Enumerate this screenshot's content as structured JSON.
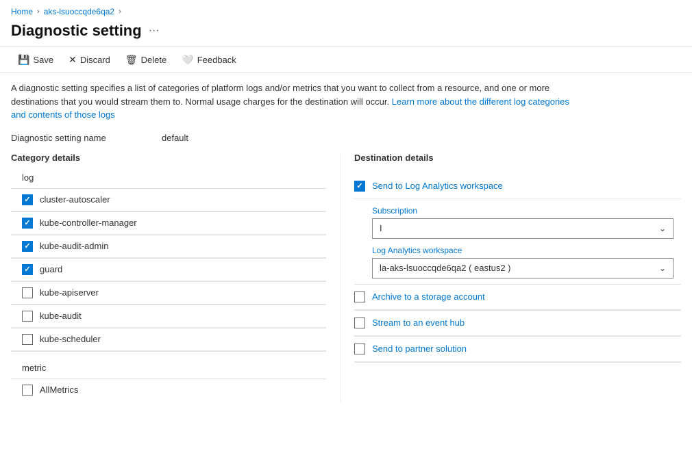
{
  "breadcrumb": {
    "home": "Home",
    "resource": "aks-lsuoccqde6qa2"
  },
  "page": {
    "title": "Diagnostic setting",
    "more_icon": "···"
  },
  "toolbar": {
    "save": "Save",
    "discard": "Discard",
    "delete": "Delete",
    "feedback": "Feedback"
  },
  "description": {
    "text1": "A diagnostic setting specifies a list of categories of platform logs and/or metrics that you want to collect from a resource, and one or more destinations that you would stream them to. Normal usage charges for the destination will occur. ",
    "link_text": "Learn more about the different log categories and contents of those logs",
    "link_href": "#"
  },
  "setting_name": {
    "label": "Diagnostic setting name",
    "value": "default"
  },
  "category_details": {
    "title": "Category details",
    "log_section": "log",
    "logs": [
      {
        "id": "cluster-autoscaler",
        "label": "cluster-autoscaler",
        "checked": true
      },
      {
        "id": "kube-controller-manager",
        "label": "kube-controller-manager",
        "checked": true
      },
      {
        "id": "kube-audit-admin",
        "label": "kube-audit-admin",
        "checked": true
      },
      {
        "id": "guard",
        "label": "guard",
        "checked": true
      },
      {
        "id": "kube-apiserver",
        "label": "kube-apiserver",
        "checked": false
      },
      {
        "id": "kube-audit",
        "label": "kube-audit",
        "checked": false
      },
      {
        "id": "kube-scheduler",
        "label": "kube-scheduler",
        "checked": false
      }
    ],
    "metric_section": "metric",
    "metrics": [
      {
        "id": "AllMetrics",
        "label": "AllMetrics",
        "checked": false
      }
    ]
  },
  "destination_details": {
    "title": "Destination details",
    "options": [
      {
        "id": "log-analytics",
        "label": "Send to Log Analytics workspace",
        "checked": true,
        "has_sub": true,
        "sub_fields": [
          {
            "label": "Subscription",
            "required": false,
            "value": "I",
            "id": "subscription-dropdown"
          },
          {
            "label": "Log Analytics workspace",
            "required": false,
            "value": "la-aks-lsuoccqde6qa2 ( eastus2 )",
            "id": "workspace-dropdown"
          }
        ]
      },
      {
        "id": "storage-account",
        "label": "Archive to a storage account",
        "checked": false,
        "has_sub": false
      },
      {
        "id": "event-hub",
        "label": "Stream to an event hub",
        "checked": false,
        "has_sub": false
      },
      {
        "id": "partner-solution",
        "label": "Send to partner solution",
        "checked": false,
        "has_sub": false
      }
    ]
  }
}
